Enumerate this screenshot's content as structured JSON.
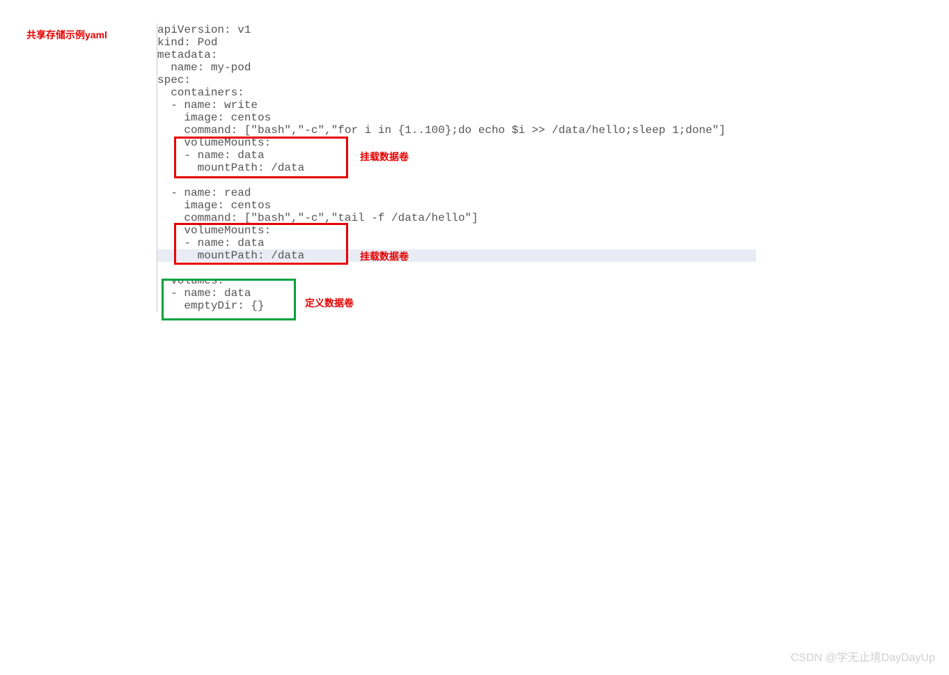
{
  "title": "共享存储示例yaml",
  "code": {
    "l1": "apiVersion: v1",
    "l2": "kind: Pod",
    "l3": "metadata:",
    "l4": "  name: my-pod",
    "l5": "spec:",
    "l6": "  containers:",
    "l7": "  - name: write",
    "l8": "    image: centos",
    "l9": "    command: [\"bash\",\"-c\",\"for i in {1..100};do echo $i >> /data/hello;sleep 1;done\"]",
    "l10": "    volumeMounts:",
    "l11": "    - name: data",
    "l12": "      mountPath: /data",
    "l13": "",
    "l14": "  - name: read",
    "l15": "    image: centos",
    "l16": "    command: [\"bash\",\"-c\",\"tail -f /data/hello\"]",
    "l17": "    volumeMounts:",
    "l18": "    - name: data",
    "l19": "      mountPath: /data",
    "l20": "",
    "l21": "  volumes:",
    "l22": "  - name: data",
    "l23": "    emptyDir: {}"
  },
  "annotations": {
    "mount1": "挂载数据卷",
    "mount2": "挂载数据卷",
    "define": "定义数据卷"
  },
  "watermark": "CSDN @学无止境DayDayUp"
}
